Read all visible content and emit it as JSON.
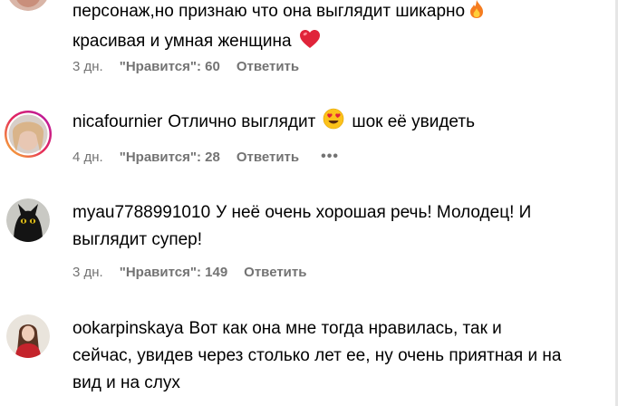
{
  "comments": [
    {
      "username": "",
      "text_line1": "персонаж,но признаю что она выглядит шикарно",
      "text_line2": "красивая и умная женщина",
      "time": "3 дн.",
      "likes": "\"Нравится\": 60",
      "reply": "Ответить",
      "emoji1": "fire-emoji",
      "emoji2": "heart-emoji"
    },
    {
      "username": "nicafournier",
      "text": "Отлично выглядит",
      "text_after": "шок её увидеть",
      "time": "4 дн.",
      "likes": "\"Нравится\": 28",
      "reply": "Ответить",
      "more": "•••",
      "emoji": "heart-eyes-emoji"
    },
    {
      "username": "myau7788991010",
      "text_line1": "У неё очень хорошая речь! Молодец! И",
      "text_line2": "выглядит супер!",
      "time": "3 дн.",
      "likes": "\"Нравится\": 149",
      "reply": "Ответить"
    },
    {
      "username": "ookarpinskaya",
      "text_line1": "Вот как она мне тогда нравилась, так и",
      "text_line2": "сейчас, увидев через столько лет ее, ну очень приятная и на",
      "text_line3": "вид и на слух"
    }
  ]
}
